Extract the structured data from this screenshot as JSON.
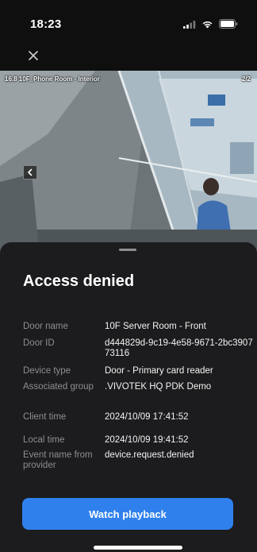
{
  "status_bar": {
    "time": "18:23",
    "icons": [
      "signal-icon",
      "wifi-icon",
      "battery-icon"
    ]
  },
  "header": {
    "close_icon": "close-icon"
  },
  "video": {
    "camera_label": "16.8 10F_Phone Room - Interior",
    "page_counter": "2/2",
    "prev_icon": "chevron-left-icon"
  },
  "sheet": {
    "title": "Access denied",
    "details": [
      {
        "label": "Door name",
        "value": "10F Server Room - Front"
      },
      {
        "label": "Door ID",
        "value": "d444829d-9c19-4e58-9671-2bc390773116"
      },
      {
        "label": "Device type",
        "value": "Door - Primary card reader"
      },
      {
        "label": "Associated group",
        "value": ".VIVOTEK HQ PDK Demo"
      },
      {
        "label": "Client time",
        "value": "2024/10/09 17:41:52"
      },
      {
        "label": "Local time",
        "value": "2024/10/09 19:41:52"
      },
      {
        "label": "Event name from provider",
        "value": "device.request.denied"
      }
    ],
    "playback_button": "Watch playback"
  },
  "colors": {
    "accent": "#2f80ed",
    "sheet_background": "#1c1c1e",
    "label_text": "#8e8e93"
  }
}
